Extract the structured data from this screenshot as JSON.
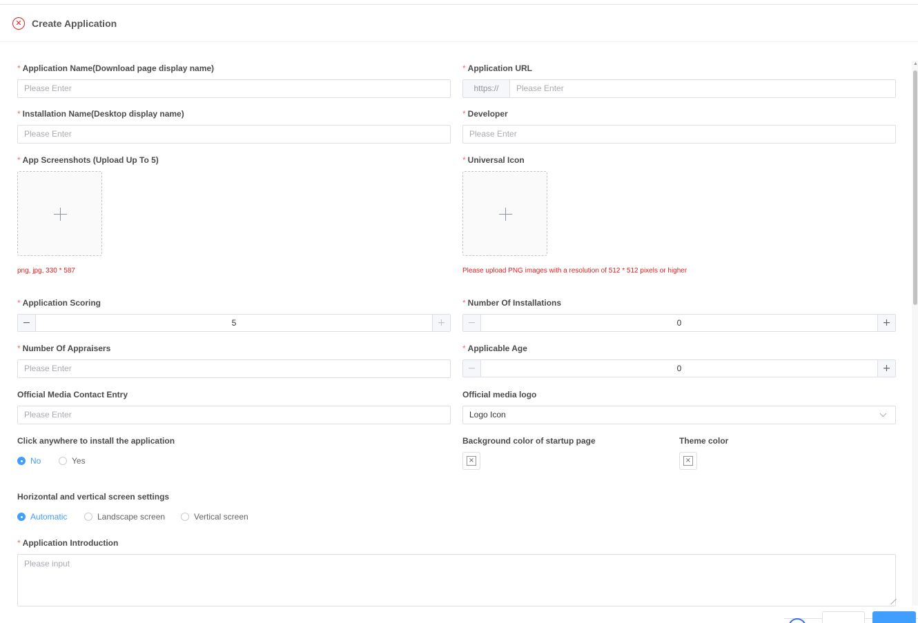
{
  "dialog": {
    "title": "Create Application",
    "close_icon": "close-circle-icon",
    "required_mark": "*"
  },
  "form": {
    "app_name": {
      "label": "Application Name(Download page display name)",
      "placeholder": "Please Enter",
      "required": true
    },
    "app_url": {
      "label": "Application URL",
      "prefix": "https://",
      "placeholder": "Please Enter",
      "required": true
    },
    "install_name": {
      "label": "Installation Name(Desktop display name)",
      "placeholder": "Please Enter",
      "required": true
    },
    "developer": {
      "label": "Developer",
      "placeholder": "Please Enter",
      "required": true
    },
    "screenshots": {
      "label": "App Screenshots (Upload Up To 5)",
      "hint": "png, jpg, 330 * 587",
      "icon": "plus-icon",
      "required": true
    },
    "universal_icon": {
      "label": "Universal Icon",
      "hint": "Please upload PNG images with a resolution of 512 * 512 pixels or higher",
      "icon": "plus-icon",
      "required": true
    },
    "scoring": {
      "label": "Application Scoring",
      "value": "5",
      "minus": "−",
      "plus": "+",
      "required": true
    },
    "installations": {
      "label": "Number Of Installations",
      "value": "0",
      "minus": "−",
      "plus": "+",
      "required": true
    },
    "appraisers": {
      "label": "Number Of Appraisers",
      "placeholder": "Please Enter",
      "required": true
    },
    "age": {
      "label": "Applicable Age",
      "value": "0",
      "minus": "−",
      "plus": "+",
      "required": true
    },
    "media_contact": {
      "label": "Official Media Contact Entry",
      "placeholder": "Please Enter"
    },
    "media_logo": {
      "label": "Official media logo",
      "value": "Logo Icon",
      "icon": "chevron-down-icon"
    },
    "click_install": {
      "label": "Click anywhere to install the application",
      "options": [
        "No",
        "Yes"
      ],
      "selected": "No"
    },
    "bg_color": {
      "label": "Background color of startup page",
      "icon": "empty-color-icon",
      "glyph": "×"
    },
    "theme_color": {
      "label": "Theme color",
      "icon": "empty-color-icon",
      "glyph": "×"
    },
    "orientation": {
      "label": "Horizontal and vertical screen settings",
      "options": [
        "Automatic",
        "Landscape screen",
        "Vertical screen"
      ],
      "selected": "Automatic"
    },
    "introduction": {
      "label": "Application Introduction",
      "placeholder": "Please input",
      "required": true
    }
  },
  "colors": {
    "accent": "#409eff",
    "required": "#f56c6c",
    "hint": "#e02020"
  }
}
